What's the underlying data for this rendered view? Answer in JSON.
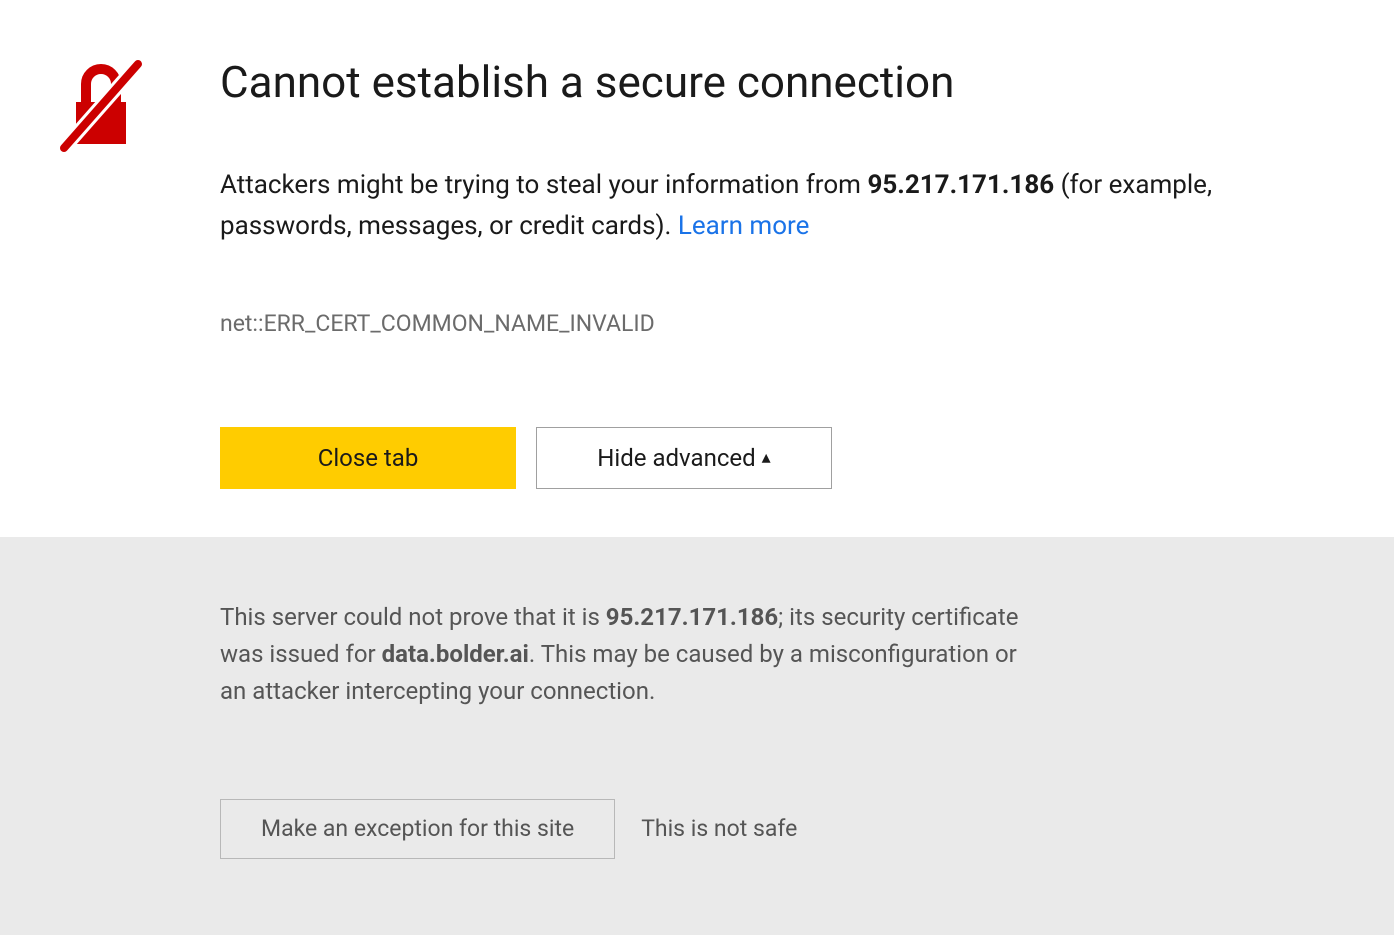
{
  "icon_name": "lock-slash-icon",
  "headline": "Cannot establish a secure connection",
  "warning": {
    "prefix": "Attackers might be trying to steal your information from ",
    "host": "95.217.171.186",
    "suffix": " (for example, passwords, messages, or credit cards). ",
    "learn_more_label": "Learn more"
  },
  "error_code": "net::ERR_CERT_COMMON_NAME_INVALID",
  "buttons": {
    "close_tab_label": "Close tab",
    "hide_advanced_label": "Hide advanced",
    "hide_advanced_arrow": "▴"
  },
  "advanced": {
    "text_prefix": "This server could not prove that it is ",
    "claimed_host": "95.217.171.186",
    "text_mid": "; its security certificate was issued for ",
    "cert_host": "data.bolder.ai",
    "text_suffix": ". This may be caused by a misconfiguration or an attacker intercepting your connection.",
    "exception_button_label": "Make an exception for this site",
    "unsafe_label": "This is not safe"
  }
}
